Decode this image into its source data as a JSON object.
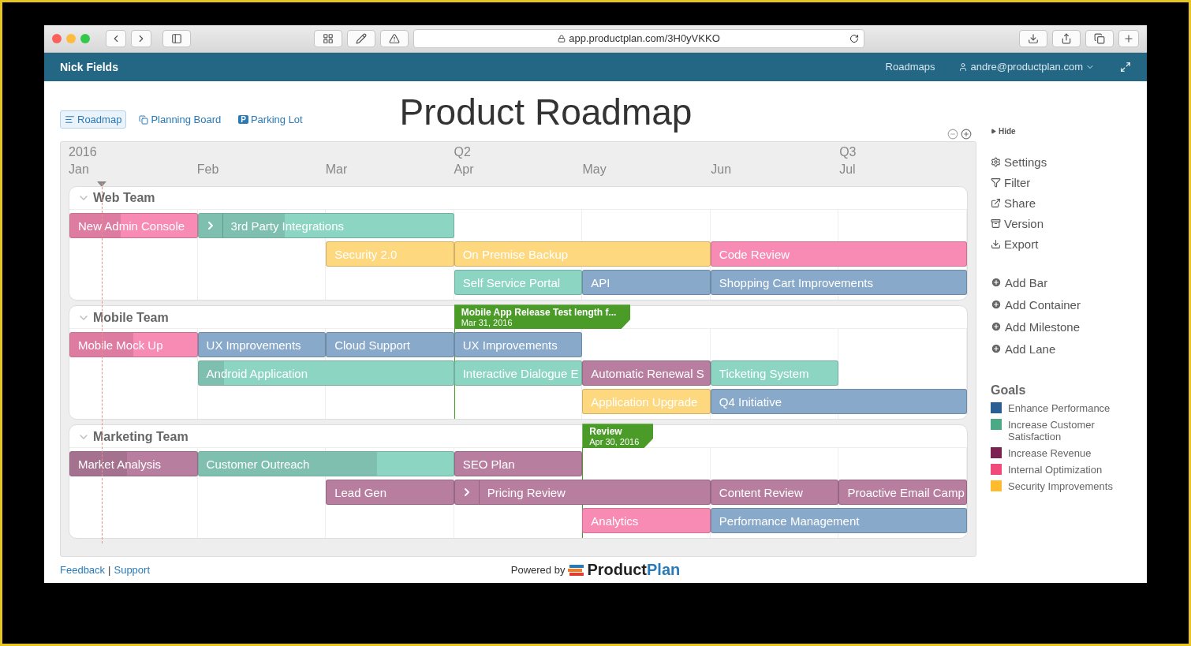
{
  "browser": {
    "url": "app.productplan.com/3H0yVKKO"
  },
  "navbar": {
    "account": "Nick Fields",
    "links": [
      "Roadmaps"
    ],
    "user": "andre@productplan.com"
  },
  "views": [
    {
      "label": "Roadmap",
      "selected": true,
      "kind": "roadmap"
    },
    {
      "label": "Planning Board",
      "selected": false,
      "kind": "board"
    },
    {
      "label": "Parking Lot",
      "selected": false,
      "kind": "parking",
      "icon_text": "P"
    }
  ],
  "title": "Product Roadmap",
  "months": [
    {
      "label": "Jan",
      "period": "2016"
    },
    {
      "label": "Feb"
    },
    {
      "label": "Mar"
    },
    {
      "label": "Apr",
      "period": "Q2"
    },
    {
      "label": "May"
    },
    {
      "label": "Jun"
    },
    {
      "label": "Jul",
      "period": "Q3"
    }
  ],
  "lanes": [
    {
      "name": "Web Team",
      "expanded": true,
      "rows": [
        [
          {
            "label": "New Admin Console",
            "wide": false,
            "color": "#f78bb3",
            "level": 0.4,
            "expandable": false
          },
          {
            "label": "3rd Party Integrations",
            "wide": true,
            "color": "#8dd5c3",
            "level": 0.34,
            "expandable": true
          },
          null
        ],
        [
          null,
          null,
          {
            "label": "Security 2.0",
            "wide": false,
            "color": "#fdd87f",
            "expandable": false
          },
          {
            "label": "On Premise Backup",
            "wide": true,
            "color": "#fdd87f",
            "expandable": false
          },
          null,
          {
            "label": "Code Review",
            "wide": true,
            "color": "#f78bb3",
            "expandable": false
          },
          null
        ],
        [
          null,
          null,
          null,
          {
            "label": "Self Service Portal",
            "wide": false,
            "color": "#8dd5c3",
            "expandable": false
          },
          {
            "label": "API",
            "wide": false,
            "color": "#88a9c9",
            "expandable": false
          },
          {
            "label": "Shopping Cart Improvements",
            "wide": true,
            "color": "#88a9c9",
            "expandable": false
          },
          null
        ]
      ]
    },
    {
      "name": "Mobile Team",
      "expanded": true,
      "rows": [
        [
          {
            "label": "Mobile Mock Up",
            "wide": false,
            "color": "#f78bb3",
            "level": 0.5,
            "expandable": false
          },
          {
            "label": "UX Improvements",
            "wide": false,
            "color": "#88a9c9",
            "expandable": false
          },
          {
            "label": "Cloud Support",
            "wide": false,
            "color": "#88a9c9",
            "expandable": false
          },
          {
            "label": "UX Improvements",
            "wide": false,
            "color": "#88a9c9",
            "expandable": false,
            "milestone": {
              "label": "Mobile App Release Test length f...",
              "date": "Mar 31, 2016"
            }
          }
        ],
        [
          null,
          {
            "label": "Android Application",
            "wide": true,
            "color": "#8dd5c3",
            "level": 0.1,
            "expandable": false
          },
          null,
          {
            "label": "Interactive Dialogue E",
            "wide": false,
            "color": "#8dd5c3",
            "expandable": false
          },
          {
            "label": "Automatic Renewal S",
            "wide": false,
            "color": "#b77e9f",
            "expandable": false
          },
          {
            "label": "Ticketing System",
            "wide": false,
            "color": "#8dd5c3",
            "expandable": false
          }
        ],
        [
          null,
          null,
          null,
          null,
          {
            "label": "Application Upgrade",
            "wide": false,
            "color": "#fdd87f",
            "expandable": false
          },
          {
            "label": "Q4 Initiative",
            "wide": true,
            "color": "#88a9c9",
            "expandable": false
          },
          null
        ]
      ]
    },
    {
      "name": "Marketing Team",
      "expanded": true,
      "rows": [
        [
          {
            "label": "Market Analysis",
            "wide": false,
            "color": "#b77e9f",
            "level": 0.45,
            "expandable": false
          },
          {
            "label": "Customer Outreach",
            "wide": true,
            "color": "#8dd5c3",
            "level": 0.7,
            "expandable": false
          },
          null,
          {
            "label": "SEO Plan",
            "wide": false,
            "color": "#b77e9f",
            "expandable": false
          }
        ],
        [
          null,
          null,
          {
            "label": "Lead Gen",
            "wide": false,
            "color": "#b77e9f",
            "expandable": false
          },
          {
            "label": "Pricing Review",
            "wide": true,
            "color": "#b77e9f",
            "expandable": true
          },
          null,
          {
            "label": "Content Review",
            "wide": false,
            "color": "#b77e9f",
            "expandable": false
          },
          {
            "label": "Proactive Email Camp",
            "wide": false,
            "color": "#b77e9f",
            "expandable": false
          }
        ],
        [
          null,
          null,
          null,
          null,
          {
            "label": "Analytics",
            "wide": false,
            "color": "#f78bb3",
            "expandable": false,
            "milestone": {
              "label": "Review",
              "date": "Apr 30, 2016"
            }
          },
          {
            "label": "Performance Management",
            "wide": true,
            "color": "#88a9c9",
            "expandable": false
          },
          null
        ]
      ]
    }
  ],
  "sidebar": {
    "hide": "Hide",
    "actions": [
      {
        "label": "Settings",
        "kind": "settings"
      },
      {
        "label": "Filter",
        "kind": "filter"
      },
      {
        "label": "Share",
        "kind": "share"
      },
      {
        "label": "Version",
        "kind": "version"
      },
      {
        "label": "Export",
        "kind": "export"
      }
    ],
    "add": [
      "Add Bar",
      "Add Container",
      "Add Milestone",
      "Add Lane"
    ],
    "goals_title": "Goals",
    "goals": [
      {
        "label": "Enhance Performance",
        "color": "#2a5f93"
      },
      {
        "label": "Increase Customer Satisfaction",
        "color": "#4aaa86"
      },
      {
        "label": "Increase Revenue",
        "color": "#7d2152"
      },
      {
        "label": "Internal Optimization",
        "color": "#f04a7d"
      },
      {
        "label": "Security Improvements",
        "color": "#fdbb2d"
      }
    ]
  },
  "footer": {
    "links": [
      "Feedback",
      "Support"
    ],
    "separator": "|",
    "powered": "Powered by",
    "logo": [
      "Product",
      "Plan"
    ]
  }
}
